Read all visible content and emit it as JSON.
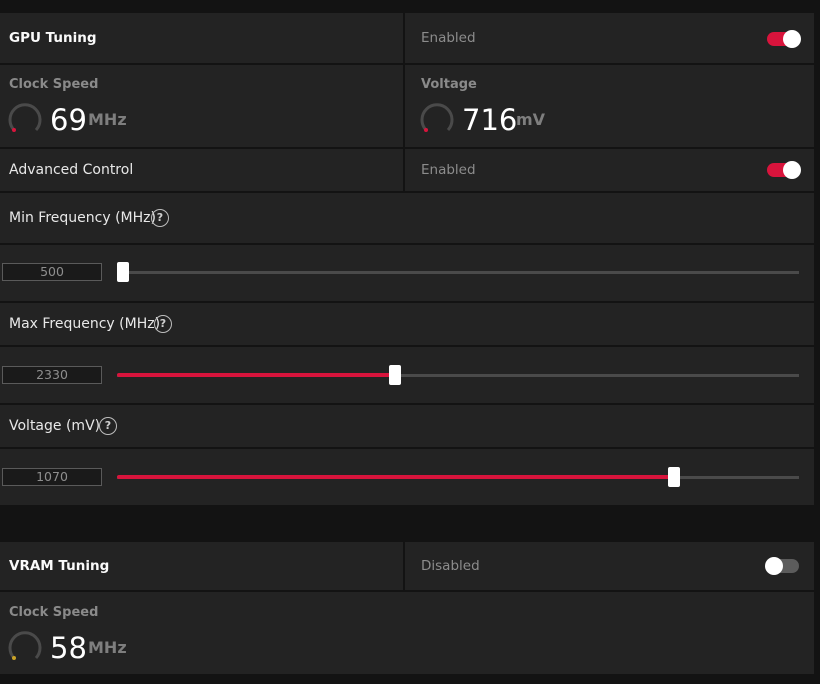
{
  "accent_color": "#d8143c",
  "gpu_tuning": {
    "title": "GPU Tuning",
    "status": "Enabled",
    "toggle_on": true
  },
  "metrics": {
    "clock_speed": {
      "label": "Clock Speed",
      "value": "69",
      "unit": "MHz"
    },
    "voltage": {
      "label": "Voltage",
      "value": "716",
      "unit": "mV"
    }
  },
  "advanced_control": {
    "label": "Advanced Control",
    "status": "Enabled",
    "toggle_on": true
  },
  "sliders": [
    {
      "label": "Min Frequency (MHz)",
      "value": "500",
      "position_fraction": 0.0
    },
    {
      "label": "Max Frequency (MHz)",
      "value": "2330",
      "position_fraction": 0.41
    },
    {
      "label": "Voltage (mV)",
      "value": "1070",
      "position_fraction": 0.82
    }
  ],
  "help_icon": "?",
  "vram_tuning": {
    "title": "VRAM Tuning",
    "status": "Disabled",
    "toggle_on": false,
    "clock_speed": {
      "label": "Clock Speed",
      "value": "58",
      "unit": "MHz"
    }
  }
}
